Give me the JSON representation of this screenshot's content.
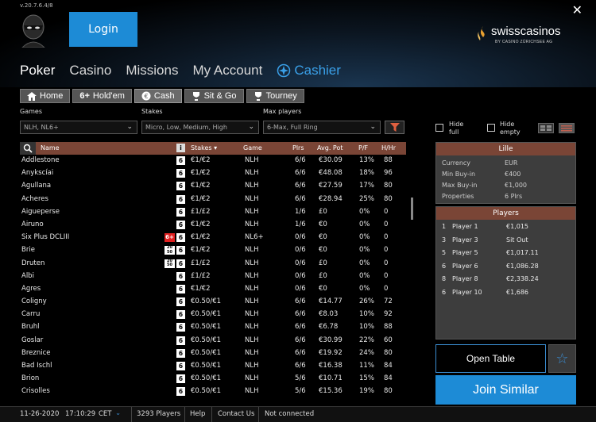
{
  "app": {
    "version": "v.20.7.6.4/8",
    "login_label": "Login",
    "close_label": "✕",
    "brand_name": "swisscasinos",
    "brand_sub": "BY CASINO ZÜRICHSEE AG"
  },
  "nav": {
    "items": [
      "Poker",
      "Casino",
      "Missions",
      "My Account"
    ],
    "cashier": "Cashier"
  },
  "subtabs": [
    {
      "label": "Home",
      "icon": "home-icon"
    },
    {
      "label": "Hold'em",
      "icon": "6plus-icon",
      "prefix": "6+"
    },
    {
      "label": "Cash",
      "icon": "euro-icon"
    },
    {
      "label": "Sit & Go",
      "icon": "trophy-icon"
    },
    {
      "label": "Tourney",
      "icon": "trophy-icon"
    }
  ],
  "filters": {
    "games_label": "Games",
    "games_value": "NLH, NL6+",
    "stakes_label": "Stakes",
    "stakes_value": "Micro, Low, Medium, High",
    "maxplayers_label": "Max players",
    "maxplayers_value": "6-Max, Full Ring"
  },
  "options": {
    "hide_full": "Hide full",
    "hide_empty": "Hide empty"
  },
  "table": {
    "headers": {
      "name": "Name",
      "info": "i",
      "stakes": "Stakes ▾",
      "game": "Game",
      "plrs": "Plrs",
      "avgpot": "Avg. Pot",
      "pf": "P/F",
      "hhr": "H/Hr"
    },
    "rows": [
      {
        "name": "Addlestone",
        "badge": "6",
        "extra": "",
        "stakes": "€1/€2",
        "game": "NLH",
        "plrs": "6/6",
        "pot": "€30.09",
        "pf": "13%",
        "hhr": "88"
      },
      {
        "name": "Anykscíai",
        "badge": "6",
        "extra": "",
        "stakes": "€1/€2",
        "game": "NLH",
        "plrs": "6/6",
        "pot": "€48.08",
        "pf": "18%",
        "hhr": "96"
      },
      {
        "name": "Agullana",
        "badge": "6",
        "extra": "",
        "stakes": "€1/€2",
        "game": "NLH",
        "plrs": "6/6",
        "pot": "€27.59",
        "pf": "17%",
        "hhr": "80"
      },
      {
        "name": "Acheres",
        "badge": "6",
        "extra": "",
        "stakes": "€1/€2",
        "game": "NLH",
        "plrs": "6/6",
        "pot": "€28.94",
        "pf": "25%",
        "hhr": "80"
      },
      {
        "name": "Aigueperse",
        "badge": "6",
        "extra": "",
        "stakes": "£1/£2",
        "game": "NLH",
        "plrs": "1/6",
        "pot": "£0",
        "pf": "0%",
        "hhr": "0"
      },
      {
        "name": "Airuno",
        "badge": "6",
        "extra": "",
        "stakes": "€1/€2",
        "game": "NLH",
        "plrs": "1/6",
        "pot": "€0",
        "pf": "0%",
        "hhr": "0"
      },
      {
        "name": "Six Plus DCLIII",
        "badge": "6",
        "extra": "6+",
        "stakes": "€1/€2",
        "game": "NL6+",
        "plrs": "0/6",
        "pot": "€0",
        "pf": "0%",
        "hhr": "0"
      },
      {
        "name": "Brie",
        "badge": "6",
        "extra": "20 50",
        "stakes": "€1/€2",
        "game": "NLH",
        "plrs": "0/6",
        "pot": "€0",
        "pf": "0%",
        "hhr": "0"
      },
      {
        "name": "Druten",
        "badge": "6",
        "extra": "20 50",
        "stakes": "£1/£2",
        "game": "NLH",
        "plrs": "0/6",
        "pot": "£0",
        "pf": "0%",
        "hhr": "0"
      },
      {
        "name": "Albi",
        "badge": "6",
        "extra": "",
        "stakes": "£1/£2",
        "game": "NLH",
        "plrs": "0/6",
        "pot": "£0",
        "pf": "0%",
        "hhr": "0"
      },
      {
        "name": "Agres",
        "badge": "6",
        "extra": "",
        "stakes": "€1/€2",
        "game": "NLH",
        "plrs": "0/6",
        "pot": "€0",
        "pf": "0%",
        "hhr": "0"
      },
      {
        "name": "Coligny",
        "badge": "6",
        "extra": "",
        "stakes": "€0.50/€1",
        "game": "NLH",
        "plrs": "6/6",
        "pot": "€14.77",
        "pf": "26%",
        "hhr": "72"
      },
      {
        "name": "Carru",
        "badge": "6",
        "extra": "",
        "stakes": "€0.50/€1",
        "game": "NLH",
        "plrs": "6/6",
        "pot": "€8.03",
        "pf": "10%",
        "hhr": "92"
      },
      {
        "name": "Bruhl",
        "badge": "6",
        "extra": "",
        "stakes": "€0.50/€1",
        "game": "NLH",
        "plrs": "6/6",
        "pot": "€6.78",
        "pf": "10%",
        "hhr": "88"
      },
      {
        "name": "Goslar",
        "badge": "6",
        "extra": "",
        "stakes": "€0.50/€1",
        "game": "NLH",
        "plrs": "6/6",
        "pot": "€30.99",
        "pf": "22%",
        "hhr": "60"
      },
      {
        "name": "Breznice",
        "badge": "6",
        "extra": "",
        "stakes": "€0.50/€1",
        "game": "NLH",
        "plrs": "6/6",
        "pot": "€19.92",
        "pf": "24%",
        "hhr": "80"
      },
      {
        "name": "Bad Ischl",
        "badge": "6",
        "extra": "",
        "stakes": "€0.50/€1",
        "game": "NLH",
        "plrs": "6/6",
        "pot": "€16.38",
        "pf": "11%",
        "hhr": "84"
      },
      {
        "name": "Brion",
        "badge": "6",
        "extra": "",
        "stakes": "€0.50/€1",
        "game": "NLH",
        "plrs": "5/6",
        "pot": "€10.71",
        "pf": "15%",
        "hhr": "84"
      },
      {
        "name": "Crisolles",
        "badge": "6",
        "extra": "",
        "stakes": "€0.50/€1",
        "game": "NLH",
        "plrs": "5/6",
        "pot": "€15.36",
        "pf": "19%",
        "hhr": "80"
      }
    ]
  },
  "table_info": {
    "title": "Lille",
    "fields": [
      {
        "label": "Currency",
        "value": "EUR"
      },
      {
        "label": "Min Buy-in",
        "value": "€400"
      },
      {
        "label": "Max Buy-in",
        "value": "€1,000"
      },
      {
        "label": "Properties",
        "value": "6 Plrs"
      }
    ]
  },
  "players": {
    "title": "Players",
    "list": [
      {
        "seat": "1",
        "name": "Player 1",
        "stack": "€1,015"
      },
      {
        "seat": "3",
        "name": "Player 3",
        "stack": "Sit Out"
      },
      {
        "seat": "5",
        "name": "Player 5",
        "stack": "€1,017.11"
      },
      {
        "seat": "6",
        "name": "Player 6",
        "stack": "€1,086.28"
      },
      {
        "seat": "8",
        "name": "Player 8",
        "stack": "€2,338.24"
      },
      {
        "seat": "6",
        "name": "Player 10",
        "stack": "€1,686"
      }
    ]
  },
  "actions": {
    "open_table": "Open Table",
    "join_similar": "Join Similar"
  },
  "status": {
    "date": "11-26-2020",
    "time": "17:10:29",
    "tz": "CET",
    "players": "3293 Players",
    "help": "Help",
    "contact": "Contact Us",
    "connection": "Not connected"
  }
}
